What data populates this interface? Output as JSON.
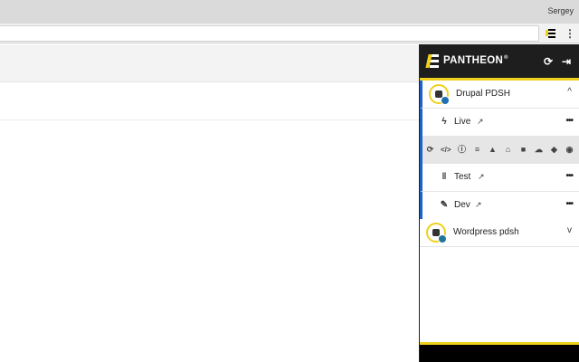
{
  "browser": {
    "profile_name": "Sergey",
    "menu_glyph": "⋮",
    "extension_icon": "pantheon-extension-icon"
  },
  "popup": {
    "brand": "PANTHEON",
    "brand_mark": "®",
    "refresh_glyph": "⟳",
    "signout_glyph": "⇥",
    "accent_color": "#efd01b",
    "active_color": "#1d62c9",
    "sites": [
      {
        "name": "Drupal PDSH",
        "chevron": "^",
        "expanded": true,
        "environments": [
          {
            "name": "Live",
            "icon": "bolt-icon",
            "glyph": "ϟ",
            "more": "•••"
          },
          {
            "name": "Test",
            "icon": "bars-icon",
            "glyph": "‖",
            "more": "•••"
          },
          {
            "name": "Dev",
            "icon": "wrench-icon",
            "glyph": "✎",
            "more": "•••"
          }
        ]
      },
      {
        "name": "Wordpress pdsh",
        "chevron": "v",
        "expanded": false
      }
    ],
    "strip_icons": [
      {
        "name": "sync-icon",
        "glyph": "⟳"
      },
      {
        "name": "code-icon",
        "glyph": "</>"
      },
      {
        "name": "info-icon",
        "glyph": "ⓘ"
      },
      {
        "name": "database-icon",
        "glyph": "≡"
      },
      {
        "name": "warning-icon",
        "glyph": "▲"
      },
      {
        "name": "home-icon",
        "glyph": "⌂"
      },
      {
        "name": "lock-icon",
        "glyph": "■"
      },
      {
        "name": "cloud-upload-icon",
        "glyph": "☁"
      },
      {
        "name": "shield-icon",
        "glyph": "◆"
      },
      {
        "name": "eye-icon",
        "glyph": "◉"
      }
    ],
    "external_link_glyph": "↗"
  }
}
